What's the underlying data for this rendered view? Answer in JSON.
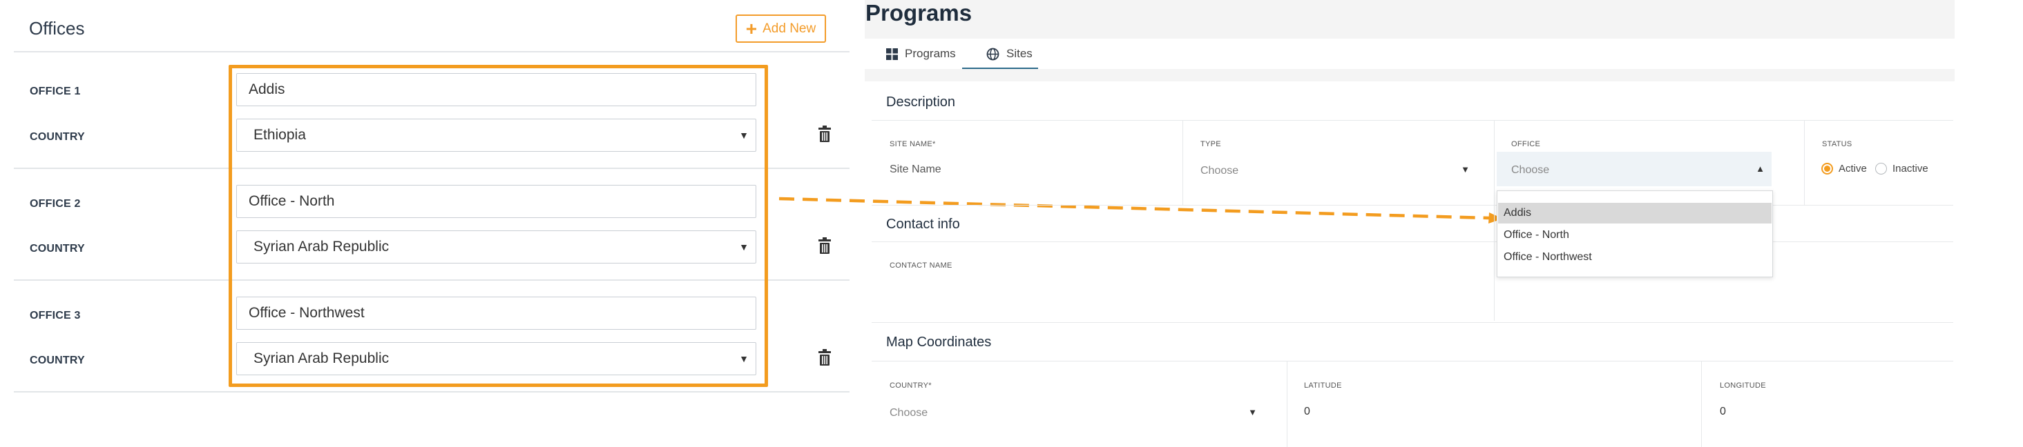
{
  "offices_panel": {
    "title": "Offices",
    "add_new_label": "Add New",
    "rows": [
      {
        "office_label": "OFFICE 1",
        "office_value": "Addis",
        "country_label": "COUNTRY",
        "country_value": "Ethiopia"
      },
      {
        "office_label": "OFFICE 2",
        "office_value": "Office - North",
        "country_label": "COUNTRY",
        "country_value": "Syrian Arab Republic"
      },
      {
        "office_label": "OFFICE 3",
        "office_value": "Office - Northwest",
        "country_label": "COUNTRY",
        "country_value": "Syrian Arab Republic"
      }
    ]
  },
  "programs_panel": {
    "title": "Programs",
    "tabs": [
      {
        "label": "Programs",
        "icon": "grid-icon",
        "active": false
      },
      {
        "label": "Sites",
        "icon": "globe-icon",
        "active": true
      }
    ],
    "description": {
      "title": "Description",
      "site_name_label": "SITE NAME*",
      "site_name_placeholder": "Site Name",
      "type_label": "TYPE",
      "type_placeholder": "Choose",
      "office_label": "OFFICE",
      "office_placeholder": "Choose",
      "office_options": [
        "Addis",
        "Office - North",
        "Office - Northwest"
      ],
      "office_highlighted": "Addis",
      "status_label": "STATUS",
      "status_options": [
        {
          "label": "Active",
          "selected": true
        },
        {
          "label": "Inactive",
          "selected": false
        }
      ]
    },
    "contact": {
      "title": "Contact info",
      "contact_name_label": "CONTACT NAME"
    },
    "map": {
      "title": "Map Coordinates",
      "country_label": "COUNTRY*",
      "country_placeholder": "Choose",
      "latitude_label": "LATITUDE",
      "latitude_value": "0",
      "longitude_label": "LONGITUDE",
      "longitude_value": "0"
    }
  },
  "colors": {
    "accent": "#f39c1f",
    "tab_active": "#2c6a8a",
    "heading": "#2d3a4a"
  }
}
